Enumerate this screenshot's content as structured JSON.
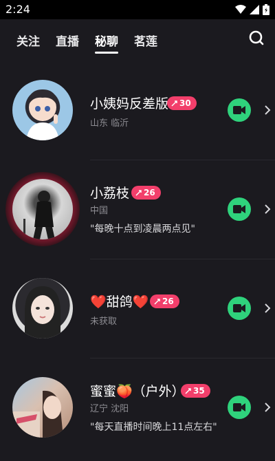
{
  "status_bar": {
    "time": "2:24"
  },
  "tabs": [
    {
      "label": "关注"
    },
    {
      "label": "直播"
    },
    {
      "label": "秘聊"
    },
    {
      "label": "茗莲"
    }
  ],
  "active_tab": "秘聊",
  "colors": {
    "background": "#1b1a1f",
    "badge": "#f23f6b",
    "video_button": "#2fd27c",
    "ring": "#8a1d33"
  },
  "items": [
    {
      "name": "小姨妈反差版",
      "badge": "30",
      "location": "山东 临沂",
      "quote": ""
    },
    {
      "name": "小荔枝",
      "badge": "26",
      "location": "中国",
      "quote": "\"每晚十点到凌晨两点见\""
    },
    {
      "name": "❤️甜鸽❤️",
      "badge": "26",
      "location": "未获取",
      "quote": ""
    },
    {
      "name": "蜜蜜🍑（户外）",
      "badge": "35",
      "location": "辽宁 沈阳",
      "quote": "\"每天直播时间晚上11点左右\""
    }
  ]
}
